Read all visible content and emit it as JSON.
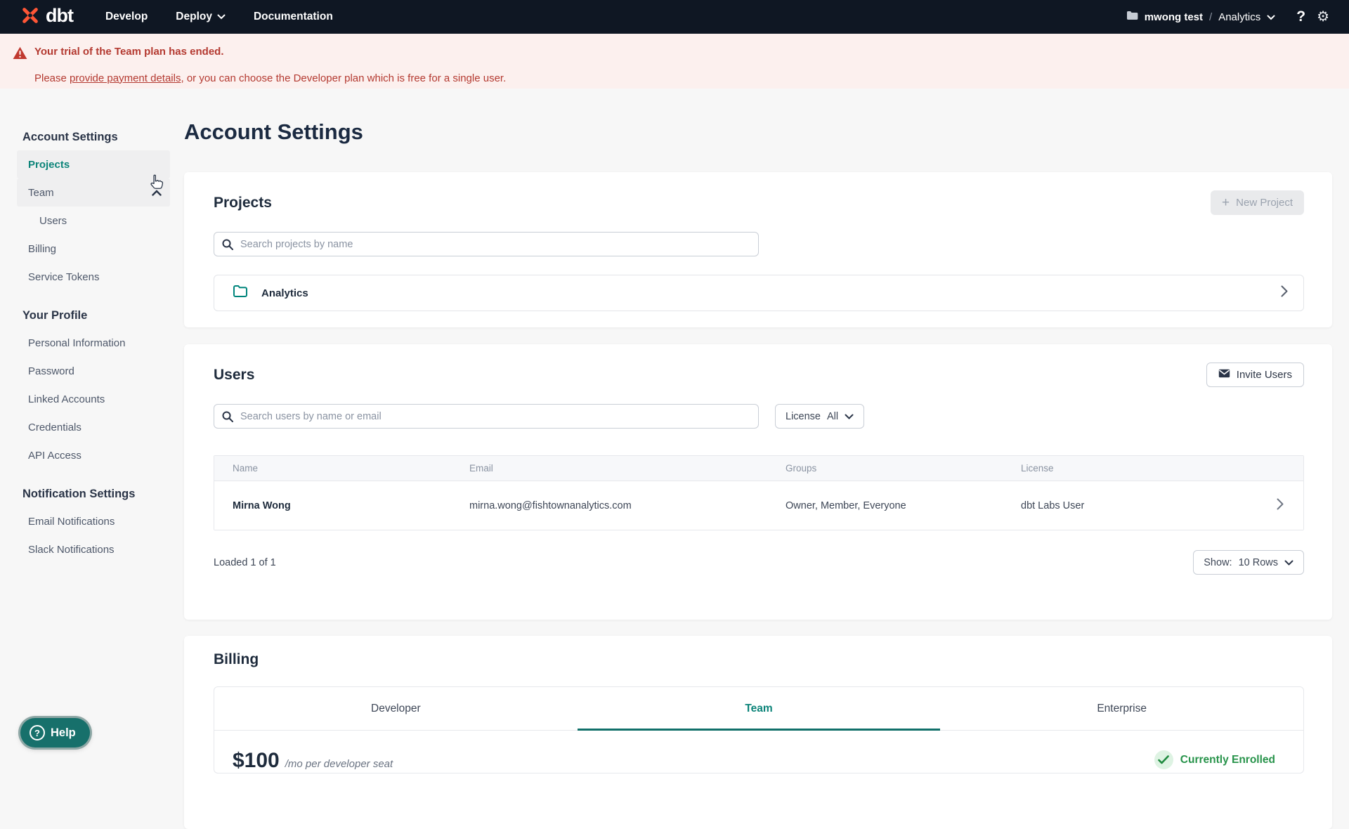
{
  "colors": {
    "nav_bg": "#0f1723",
    "brand_orange": "#ff5636",
    "accent_teal": "#0c8479",
    "teal_underline": "#11706a",
    "alert_red": "#b43a31",
    "alert_bg": "#fcf0ee",
    "success_green": "#27934a",
    "heading_navy": "#1e2b3c"
  },
  "topnav": {
    "brand": "dbt",
    "links": [
      {
        "label": "Develop"
      },
      {
        "label": "Deploy"
      },
      {
        "label": "Documentation"
      }
    ],
    "account": "mwong test",
    "separator": "/",
    "project": "Analytics",
    "help_glyph": "?",
    "gear_glyph": "⚙"
  },
  "banner": {
    "title": "Your trial of the Team plan has ended.",
    "body_prefix": "Please ",
    "link": "provide payment details",
    "body_suffix": ", or you can choose the Developer plan which is free for a single user."
  },
  "sidebar": {
    "sections": [
      {
        "heading": "Account Settings",
        "items": [
          {
            "label": "Projects"
          },
          {
            "label": "Team"
          },
          {
            "label": "Users"
          },
          {
            "label": "Billing"
          },
          {
            "label": "Service Tokens"
          }
        ]
      },
      {
        "heading": "Your Profile",
        "items": [
          {
            "label": "Personal Information"
          },
          {
            "label": "Password"
          },
          {
            "label": "Linked Accounts"
          },
          {
            "label": "Credentials"
          },
          {
            "label": "API Access"
          }
        ]
      },
      {
        "heading": "Notification Settings",
        "items": [
          {
            "label": "Email Notifications"
          },
          {
            "label": "Slack Notifications"
          }
        ]
      }
    ]
  },
  "page_title": "Account Settings",
  "projects_card": {
    "heading": "Projects",
    "new_project_label": "New Project",
    "plus_glyph": "+",
    "search_placeholder": "Search projects by name",
    "rows": [
      {
        "name": "Analytics"
      }
    ]
  },
  "users_card": {
    "heading": "Users",
    "invite_label": "Invite Users",
    "search_placeholder": "Search users by name or email",
    "license_filter_label": "License",
    "license_filter_value": "All",
    "table": {
      "columns": [
        "Name",
        "Email",
        "Groups",
        "License"
      ],
      "rows": [
        {
          "name": "Mirna Wong",
          "email": "mirna.wong@fishtownanalytics.com",
          "groups": "Owner, Member, Everyone",
          "license": "dbt Labs User"
        }
      ]
    },
    "loaded_text": "Loaded 1 of 1",
    "show_label": "Show:",
    "show_value": "10 Rows"
  },
  "billing_card": {
    "heading": "Billing",
    "tabs": [
      {
        "label": "Developer"
      },
      {
        "label": "Team"
      },
      {
        "label": "Enterprise"
      }
    ],
    "price": "$100",
    "price_suffix": "/mo per developer seat",
    "enrolled_label": "Currently Enrolled"
  },
  "help_button": {
    "label": "Help",
    "glyph": "?"
  }
}
